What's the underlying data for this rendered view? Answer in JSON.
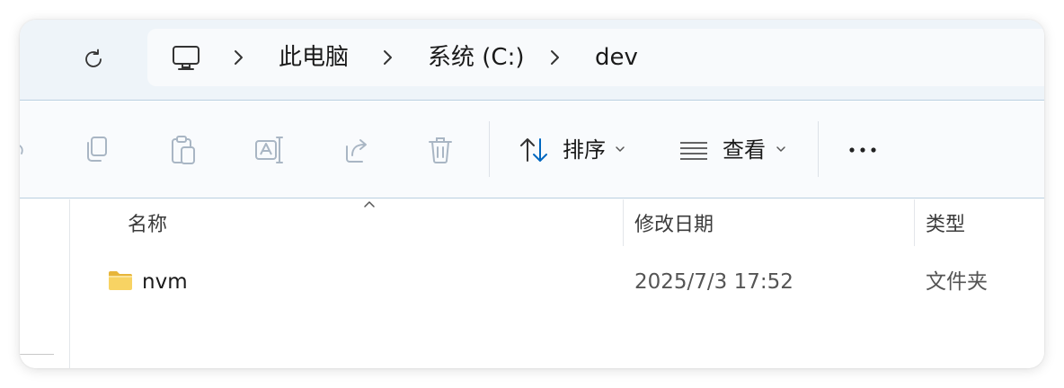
{
  "address_bar": {
    "breadcrumbs": [
      "此电脑",
      "系统 (C:)",
      "dev"
    ],
    "root_icon": "computer-icon",
    "separator_icon": "chevron-right-icon"
  },
  "toolbar": {
    "refresh_icon": "refresh-icon",
    "actions": [
      {
        "name": "copy",
        "icon": "copy-icon",
        "enabled": false
      },
      {
        "name": "paste",
        "icon": "paste-icon",
        "enabled": false
      },
      {
        "name": "rename",
        "icon": "rename-icon",
        "enabled": false
      },
      {
        "name": "share",
        "icon": "share-icon",
        "enabled": false
      },
      {
        "name": "delete",
        "icon": "trash-icon",
        "enabled": false
      }
    ],
    "sort_label": "排序",
    "view_label": "查看",
    "more_icon": "more-icon"
  },
  "file_list": {
    "columns": [
      "名称",
      "修改日期",
      "类型"
    ],
    "sorted_by": "名称",
    "rows": [
      {
        "name": "nvm",
        "modified": "2025/7/3 17:52",
        "type": "文件夹",
        "icon": "folder-icon"
      }
    ]
  },
  "colors": {
    "accent": "#0067c0",
    "disabled_icon": "#a9b6c4",
    "folder_yellow": "#f6c94a",
    "address_bg": "#eef4f9",
    "border": "#b9cfe0"
  }
}
